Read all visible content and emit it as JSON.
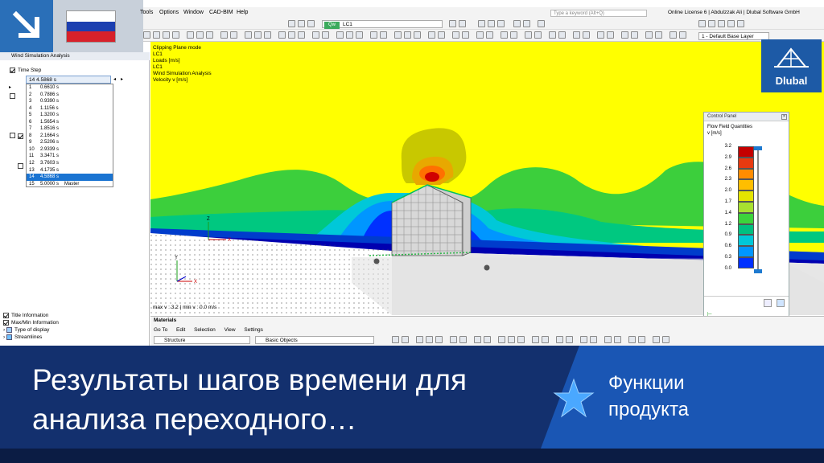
{
  "app": {
    "menu": [
      "Tools",
      "Options",
      "Window",
      "CAD-BIM",
      "Help"
    ],
    "search_placeholder": "Type a keyword (Alt+Q)",
    "license": "Online License 6 | Abdulzzak Ali | Dlubal Software GmbH",
    "loadcase_tag": "Qw",
    "loadcase": "LC1",
    "layer": "1 - Default Base Layer"
  },
  "navigator": {
    "title": "Wind Simulation Analysis",
    "time_step_label": "Time Step",
    "selected_time": "14   4.5868 s",
    "time_steps": [
      {
        "n": "1",
        "t": "0.6610 s",
        "note": ""
      },
      {
        "n": "2",
        "t": "0.7886 s",
        "note": ""
      },
      {
        "n": "3",
        "t": "0.9390 s",
        "note": ""
      },
      {
        "n": "4",
        "t": "1.1156 s",
        "note": ""
      },
      {
        "n": "5",
        "t": "1.3200 s",
        "note": ""
      },
      {
        "n": "6",
        "t": "1.5654 s",
        "note": ""
      },
      {
        "n": "7",
        "t": "1.8516 s",
        "note": ""
      },
      {
        "n": "8",
        "t": "2.1664 s",
        "note": ""
      },
      {
        "n": "9",
        "t": "2.5206 s",
        "note": ""
      },
      {
        "n": "10",
        "t": "2.9339 s",
        "note": ""
      },
      {
        "n": "11",
        "t": "3.3471 s",
        "note": ""
      },
      {
        "n": "12",
        "t": "3.7603 s",
        "note": ""
      },
      {
        "n": "13",
        "t": "4.1735 s",
        "note": ""
      },
      {
        "n": "14",
        "t": "4.5868 s",
        "note": ""
      },
      {
        "n": "15",
        "t": "5.0000 s",
        "note": "Master"
      }
    ],
    "selected_index": 13,
    "bottom_items": [
      "Title Information",
      "Max/Min Information",
      "Type of display",
      "Streamlines"
    ]
  },
  "viewport": {
    "info_lines": [
      "Clipping Plane mode",
      "LC1",
      "Loads [m/s]",
      "LC1",
      "Wind Simulation Analysis",
      "Velocity v [m/s]"
    ],
    "maxmin": "max v : 3.2 | min v : 0.0 m/s",
    "axis_labels": {
      "x": "X",
      "y": "Y",
      "z": "Z"
    }
  },
  "control_panel": {
    "title": "Control Panel",
    "heading": "Flow Field Quantities",
    "unit": "v [m/s]",
    "legend": [
      {
        "v": "3.2",
        "c": "#c40000"
      },
      {
        "v": "2.9",
        "c": "#e83a10"
      },
      {
        "v": "2.6",
        "c": "#ff8c00"
      },
      {
        "v": "2.3",
        "c": "#ffbe00"
      },
      {
        "v": "2.0",
        "c": "#e4e400"
      },
      {
        "v": "1.7",
        "c": "#a8e030"
      },
      {
        "v": "1.4",
        "c": "#3cd43c"
      },
      {
        "v": "1.2",
        "c": "#00c080"
      },
      {
        "v": "0.9",
        "c": "#00c8d8"
      },
      {
        "v": "0.6",
        "c": "#0096ff"
      },
      {
        "v": "0.3",
        "c": "#0030ff"
      },
      {
        "v": "0.0",
        "c": "#000090"
      }
    ]
  },
  "materials": {
    "title": "Materials",
    "menu": [
      "Go To",
      "Edit",
      "Selection",
      "View",
      "Settings"
    ],
    "combo_structure": "Structure",
    "combo_objects": "Basic Objects"
  },
  "logo": {
    "text": "Dlubal"
  },
  "banner": {
    "headline": "Результаты шагов времени для\nанализа переходного…",
    "feature": "Функции\nпродукта"
  },
  "colors": {
    "banner_dark": "#13306e",
    "banner_light": "#1a56b4",
    "badge_blue": "#2a6fb8",
    "viewport_yellow": "#ffff00"
  }
}
